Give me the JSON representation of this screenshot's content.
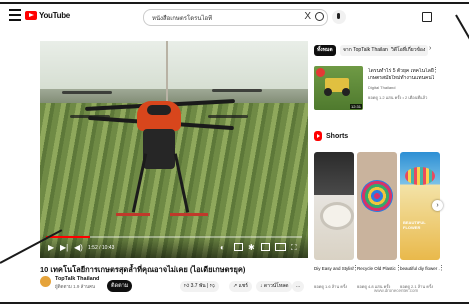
{
  "topbar": {
    "logo_text": "YouTube",
    "search_query": "หนังสือเกษตรโดรนไอที",
    "clear_glyph": "X"
  },
  "player": {
    "time": "1:52 / 10:43",
    "progress": 0.17
  },
  "video": {
    "title": "10 เทคโนโลยีการเกษตรสุดล้ำที่คุณอาจไม่เคย (ไอเดียเกษตรยุค)",
    "channel": "TopTalk Thailand",
    "subscribers": "ผู้ติดตาม 1.9 ล้านคน",
    "subscribe_label": "ติดตาม",
    "likes": "3.7 พัน",
    "share_label": "แชร์",
    "download_label": "ดาวน์โหลด",
    "more_label": "..."
  },
  "sidebar": {
    "chips": [
      "ทั้งหมด",
      "จาก TopTalk Thailand",
      "วิดีโอที่เกี่ยวข้อง"
    ],
    "recommended": [
      {
        "title": "โดรนทำไร่ 5 ตัวยุค เทคโนโลยี",
        "subtitle": "เกษตรสมัยใหม่ทำงานแทนคนได้จริง!",
        "channel": "Digital Thailand",
        "meta": "ยอดดู 1.2 แสน ครั้ง • 2 เดือนที่แล้ว",
        "duration": "12:31"
      }
    ],
    "shorts_heading": "Shorts",
    "shorts": [
      {
        "title": "Diy Easy and Stylish ...",
        "meta": "ยอดดู 1.6 ล้าน ครั้ง"
      },
      {
        "title": "Recycle Old Plastic ...",
        "meta": "ยอดดู 4.8 แสน ครั้ง"
      },
      {
        "title": "beautiful diy flower ...",
        "meta": "ยอดดู 2.1 ล้าน ครั้ง"
      }
    ],
    "short3_overlay": "BEAUTIFUL FLOWER"
  },
  "watermark": "www.dronecenter.com"
}
